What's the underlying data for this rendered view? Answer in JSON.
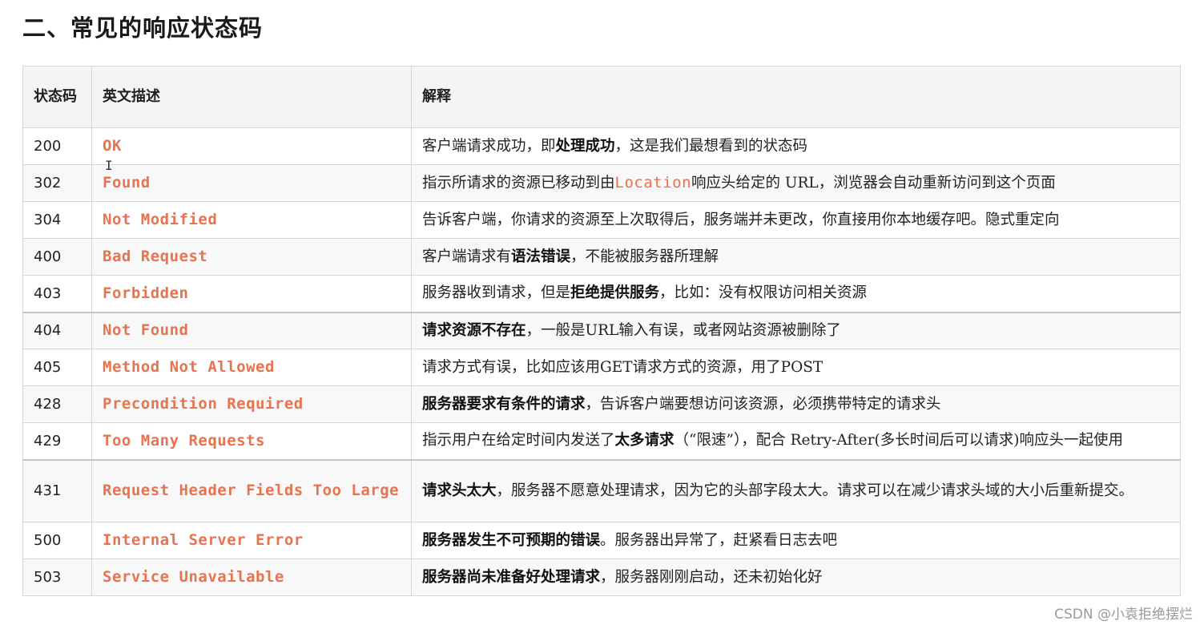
{
  "page": {
    "title": "二、常见的响应状态码",
    "watermark": "CSDN @小袁拒绝摆烂"
  },
  "table": {
    "headers": {
      "code": "状态码",
      "description": "英文描述",
      "explanation": "解释"
    },
    "rows": [
      {
        "code": "200",
        "description": "OK",
        "explanation": [
          {
            "t": "客户端请求成功，即"
          },
          {
            "t": "处理成功",
            "b": true
          },
          {
            "t": "，这是我们最想看到的状态码"
          }
        ]
      },
      {
        "code": "302",
        "description": "Found",
        "explanation": [
          {
            "t": "指示所请求的资源已移动到由"
          },
          {
            "t": "Location",
            "m": true
          },
          {
            "t": "响应头给定的 URL，浏览器会自动重新访问到这个页面"
          }
        ]
      },
      {
        "code": "304",
        "description": "Not Modified",
        "explanation": [
          {
            "t": "告诉客户端，你请求的资源至上次取得后，服务端并未更改，你直接用你本地缓存吧。隐式重定向"
          }
        ]
      },
      {
        "code": "400",
        "description": "Bad Request",
        "explanation": [
          {
            "t": "客户端请求有"
          },
          {
            "t": "语法错误",
            "b": true
          },
          {
            "t": "，不能被服务器所理解"
          }
        ]
      },
      {
        "code": "403",
        "description": "Forbidden",
        "explanation": [
          {
            "t": "服务器收到请求，但是"
          },
          {
            "t": "拒绝提供服务",
            "b": true
          },
          {
            "t": "，比如：没有权限访问相关资源"
          }
        ]
      },
      {
        "code": "404",
        "description": "Not Found",
        "explanation": [
          {
            "t": "请求资源不存在",
            "b": true
          },
          {
            "t": "，一般是URL输入有误，或者网站资源被删除了"
          }
        ]
      },
      {
        "code": "405",
        "description": "Method Not Allowed",
        "explanation": [
          {
            "t": "请求方式有误，比如应该用GET请求方式的资源，用了POST"
          }
        ]
      },
      {
        "code": "428",
        "description": "Precondition Required",
        "explanation": [
          {
            "t": "服务器要求有条件的请求",
            "b": true
          },
          {
            "t": "，告诉客户端要想访问该资源，必须携带特定的请求头"
          }
        ]
      },
      {
        "code": "429",
        "description": "Too Many Requests",
        "explanation": [
          {
            "t": "指示用户在给定时间内发送了"
          },
          {
            "t": "太多请求",
            "b": true
          },
          {
            "t": "（“限速”），配合 Retry-After(多长时间后可以请求)响应头一起使用"
          }
        ]
      },
      {
        "code": "431",
        "description": "Request Header Fields Too Large",
        "explanation": [
          {
            "t": "请求头太大",
            "b": true
          },
          {
            "t": "，服务器不愿意处理请求，因为它的头部字段太大。请求可以在减少请求头域的大小后重新提交。"
          }
        ]
      },
      {
        "code": "500",
        "description": "Internal Server Error",
        "explanation": [
          {
            "t": "服务器发生不可预期的错误",
            "b": true
          },
          {
            "t": "。服务器出异常了，赶紧看日志去吧"
          }
        ]
      },
      {
        "code": "503",
        "description": "Service Unavailable",
        "explanation": [
          {
            "t": "服务器尚未准备好处理请求",
            "b": true
          },
          {
            "t": "，服务器刚刚启动，还未初始化好"
          }
        ]
      }
    ]
  }
}
